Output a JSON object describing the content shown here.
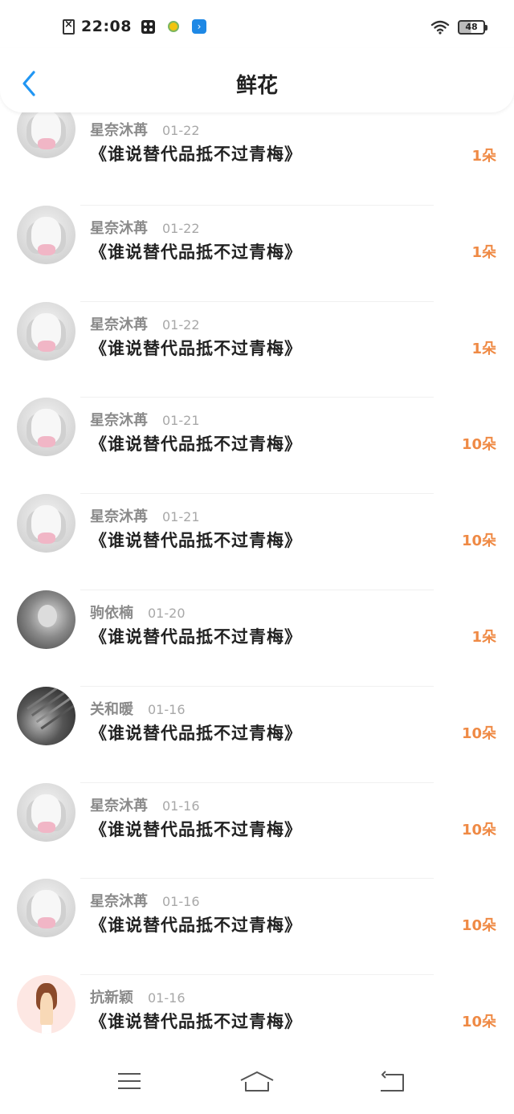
{
  "status_bar": {
    "time": "22:08",
    "battery": "48"
  },
  "header": {
    "title": "鲜花"
  },
  "items": [
    {
      "user": "星奈沐苒",
      "date": "01-22",
      "title": "《谁说替代品抵不过青梅》",
      "amount": "1朵",
      "avatar": "anime"
    },
    {
      "user": "星奈沐苒",
      "date": "01-22",
      "title": "《谁说替代品抵不过青梅》",
      "amount": "1朵",
      "avatar": "anime"
    },
    {
      "user": "星奈沐苒",
      "date": "01-22",
      "title": "《谁说替代品抵不过青梅》",
      "amount": "1朵",
      "avatar": "anime"
    },
    {
      "user": "星奈沐苒",
      "date": "01-21",
      "title": "《谁说替代品抵不过青梅》",
      "amount": "10朵",
      "avatar": "anime"
    },
    {
      "user": "星奈沐苒",
      "date": "01-21",
      "title": "《谁说替代品抵不过青梅》",
      "amount": "10朵",
      "avatar": "anime"
    },
    {
      "user": "驹依楠",
      "date": "01-20",
      "title": "《谁说替代品抵不过青梅》",
      "amount": "1朵",
      "avatar": "photo1"
    },
    {
      "user": "关和暖",
      "date": "01-16",
      "title": "《谁说替代品抵不过青梅》",
      "amount": "10朵",
      "avatar": "photo2"
    },
    {
      "user": "星奈沐苒",
      "date": "01-16",
      "title": "《谁说替代品抵不过青梅》",
      "amount": "10朵",
      "avatar": "anime"
    },
    {
      "user": "星奈沐苒",
      "date": "01-16",
      "title": "《谁说替代品抵不过青梅》",
      "amount": "10朵",
      "avatar": "anime"
    },
    {
      "user": "抗新颖",
      "date": "01-16",
      "title": "《谁说替代品抵不过青梅》",
      "amount": "10朵",
      "avatar": "girl"
    }
  ],
  "colors": {
    "accent_blue": "#2196f3",
    "amount_orange": "#ef8a45"
  },
  "icons": {
    "back": "chevron-left-icon",
    "menu": "menu-icon",
    "home": "home-icon",
    "return": "return-icon"
  }
}
